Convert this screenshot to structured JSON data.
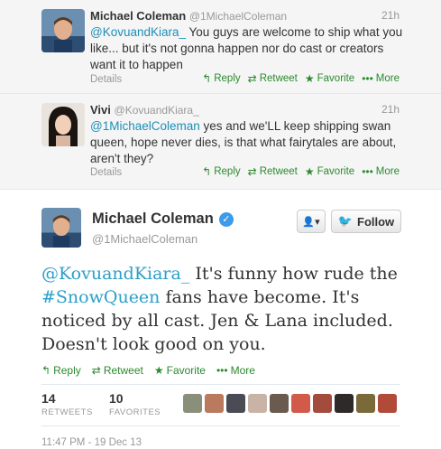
{
  "replies": [
    {
      "name": "Michael Coleman",
      "handle": "@1MichaelColeman",
      "time": "21h",
      "mention": "@KovuandKiara_",
      "text": " You guys are welcome to ship what you like... but it's not gonna happen nor do cast or creators want it to happen",
      "details": "Details"
    },
    {
      "name": "Vivi",
      "handle": "@KovuandKiara_",
      "time": "21h",
      "mention": "@1MichaelColeman",
      "text": " yes and we'LL keep shipping swan queen, hope never dies, is that what fairytales are about, aren't they?",
      "details": "Details"
    }
  ],
  "actions": {
    "reply": "Reply",
    "retweet": "Retweet",
    "favorite": "Favorite",
    "more": "More"
  },
  "main": {
    "name": "Michael Coleman",
    "handle": "@1MichaelColeman",
    "follow_label": "Follow",
    "mention": "@KovuandKiara_",
    "text_a": " It's funny how rude the ",
    "hashtag": "#SnowQueen",
    "text_b": " fans have become. It's noticed by all cast. Jen & Lana included. Doesn't look good on you.",
    "retweets_count": "14",
    "retweets_label": "RETWEETS",
    "favorites_count": "10",
    "favorites_label": "FAVORITES",
    "timestamp": "11:47 PM - 19 Dec 13"
  },
  "colors": {
    "action_green": "#2b8a2e",
    "link_blue": "#2aa0c8",
    "verified_blue": "#3d9be9"
  },
  "icons": [
    "reply-icon",
    "retweet-icon",
    "favorite-icon",
    "more-icon",
    "verified-icon",
    "user-dropdown-icon",
    "bird-icon"
  ],
  "favoriter_avatar_count": 10
}
